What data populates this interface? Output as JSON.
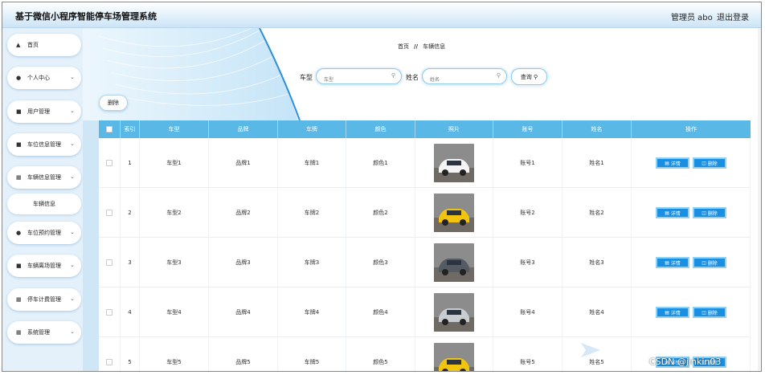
{
  "header": {
    "title": "基于微信小程序智能停车场管理系统",
    "admin": "管理员 abo",
    "logout": "退出登录"
  },
  "sidebar": {
    "items": [
      {
        "label": "首页",
        "icon": "home-icon"
      },
      {
        "label": "个人中心",
        "icon": "user-icon"
      },
      {
        "label": "用户管理",
        "icon": "lock-icon"
      },
      {
        "label": "车位信息管理",
        "icon": "car-icon"
      },
      {
        "label": "车辆信息管理",
        "icon": "grid-icon"
      },
      {
        "label": "车位预约管理",
        "icon": "user-icon"
      },
      {
        "label": "车辆离场管理",
        "icon": "lock-icon"
      },
      {
        "label": "停车计费管理",
        "icon": "grid-icon"
      },
      {
        "label": "系统管理",
        "icon": "apps-icon"
      }
    ],
    "sub_item": "车辆信息"
  },
  "breadcrumb": {
    "home": "首页",
    "sep": "//",
    "current": "车辆信息"
  },
  "search": {
    "type_label": "车型",
    "type_placeholder": "车型",
    "name_label": "姓名",
    "name_placeholder": "姓名",
    "query_label": "查询"
  },
  "toolbar": {
    "delete_label": "删除"
  },
  "table": {
    "headers": [
      "",
      "索引",
      "车型",
      "品牌",
      "车牌",
      "颜色",
      "照片",
      "账号",
      "姓名",
      "操作"
    ],
    "rows": [
      {
        "index": "1",
        "type": "车型1",
        "brand": "品牌1",
        "plate": "车牌1",
        "color": "颜色1",
        "account": "账号1",
        "name": "姓名1",
        "car_color": "#f4f4f4"
      },
      {
        "index": "2",
        "type": "车型2",
        "brand": "品牌2",
        "plate": "车牌2",
        "color": "颜色2",
        "account": "账号2",
        "name": "姓名2",
        "car_color": "#f1c40f"
      },
      {
        "index": "3",
        "type": "车型3",
        "brand": "品牌3",
        "plate": "车牌3",
        "color": "颜色3",
        "account": "账号3",
        "name": "姓名3",
        "car_color": "#555b63"
      },
      {
        "index": "4",
        "type": "车型4",
        "brand": "品牌4",
        "plate": "车牌4",
        "color": "颜色4",
        "account": "账号4",
        "name": "姓名4",
        "car_color": "#c9ccd0"
      },
      {
        "index": "5",
        "type": "车型5",
        "brand": "品牌5",
        "plate": "车牌5",
        "color": "颜色5",
        "account": "账号5",
        "name": "姓名5",
        "car_color": "#f1c40f"
      }
    ],
    "detail_label": "详情",
    "delete_label": "删除"
  },
  "watermark": "CSDN @jinkin03",
  "colors": {
    "accent": "#1a8ee0",
    "header_row": "#5ab8e6",
    "sidebar_bg": "#e4f1fb"
  }
}
